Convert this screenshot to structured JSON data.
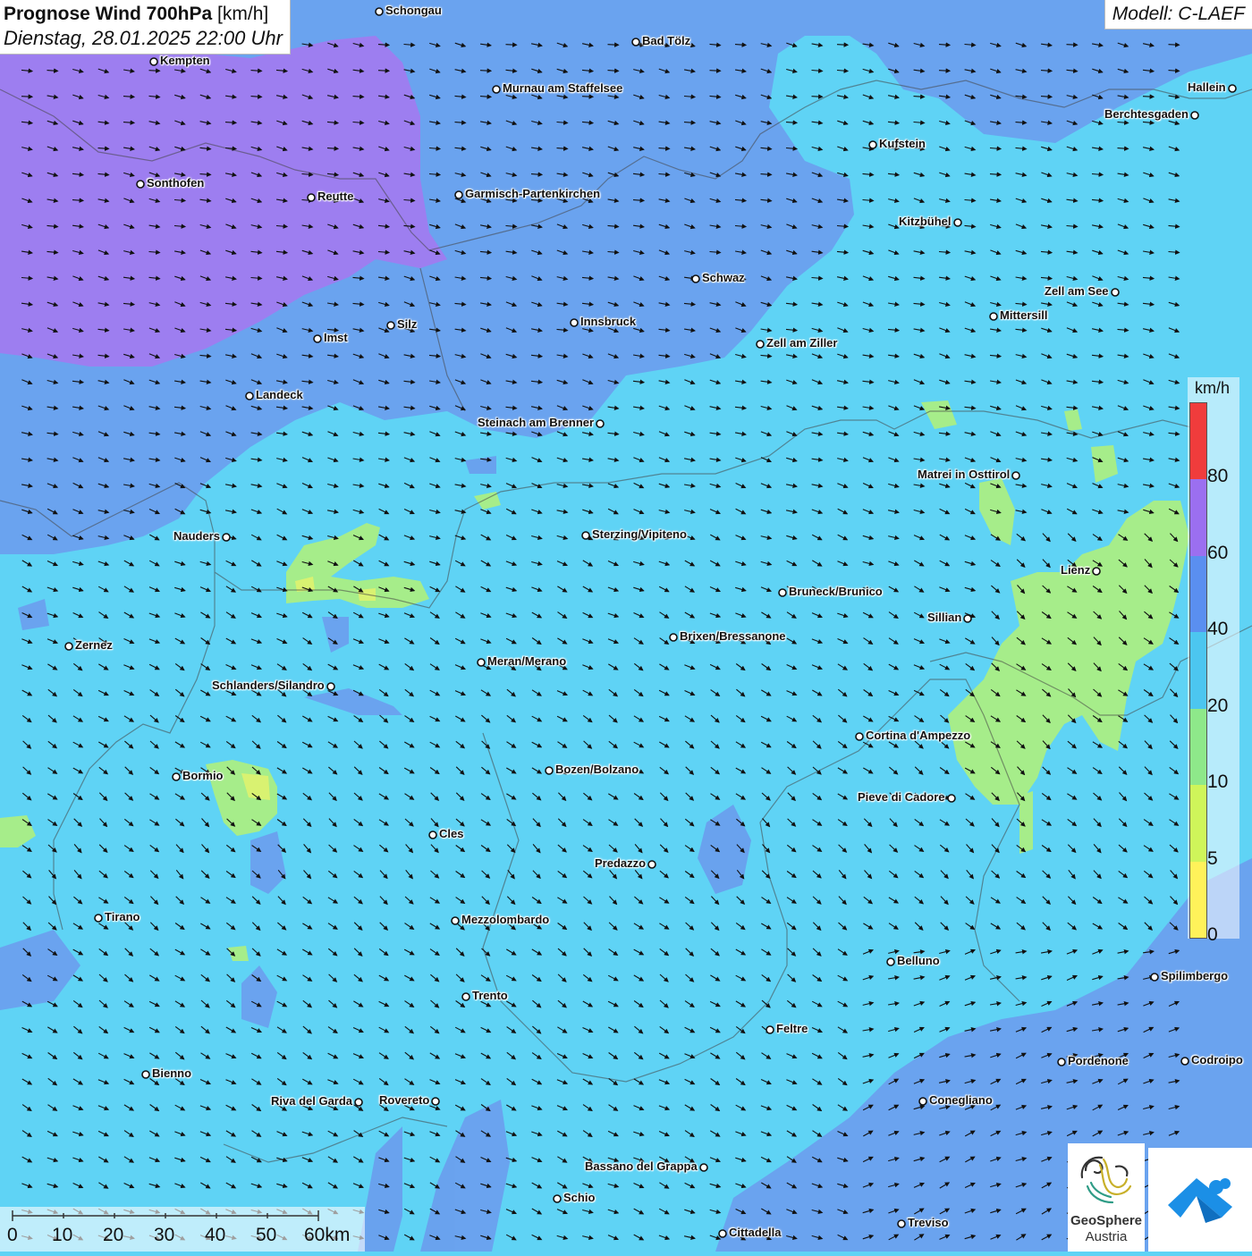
{
  "header": {
    "title_bold": "Prognose Wind 700hPa",
    "title_unit": " [km/h]",
    "datetime": "Dienstag, 28.01.2025 22:00 Uhr",
    "model": "Modell: C-LAEF"
  },
  "legend": {
    "unit": "km/h",
    "ticks": [
      "0",
      "5",
      "10",
      "20",
      "40",
      "60",
      "80"
    ],
    "colors": [
      "#fff25a",
      "#cff55a",
      "#8ee88a",
      "#4cc6f0",
      "#5a8ff0",
      "#9b6ff0",
      "#f03c3c"
    ]
  },
  "colors": {
    "wind_10_20": "#5fd3f5",
    "wind_20_40": "#6aa0ee",
    "wind_40_60": "#9d7ef0",
    "wind_5_10": "#a6ed8a",
    "wind_0_5": "#e6f36a"
  },
  "scale_bar": {
    "labels": [
      "0",
      "10",
      "20",
      "30",
      "40",
      "50",
      "60km"
    ]
  },
  "logos": {
    "geosphere_line1": "GeoSphere",
    "geosphere_line2": "Austria",
    "geosphere_icon": "geosphere-logo-icon",
    "app_icon": "wetter-app-logo-icon"
  },
  "cities": [
    "Schongau",
    "Bad Tölz",
    "Kempten",
    "Murnau am Staffelsee",
    "Hallein",
    "Berchtesgaden",
    "Kufstein",
    "Sonthofen",
    "Reutte",
    "Garmisch-Partenkirchen",
    "Kitzbühel",
    "Schwaz",
    "Zell am See",
    "Innsbruck",
    "Silz",
    "Imst",
    "Mittersill",
    "Zell am Ziller",
    "Landeck",
    "Steinach am Brenner",
    "Matrei in Osttirol",
    "Nauders",
    "Sterzing/Vipiteno",
    "Lienz",
    "Bruneck/Brunico",
    "Sillian",
    "Zernez",
    "Brixen/Bressanone",
    "Meran/Merano",
    "Schlanders/Silandro",
    "Cortina d'Ampezzo",
    "Bozen/Bolzano",
    "Bormio",
    "Pieve di Cadore",
    "Cles",
    "Predazzo",
    "Tirano",
    "Mezzolombardo",
    "Belluno",
    "Spilimbergo",
    "Trento",
    "Feltre",
    "Pordenone",
    "Codroipo",
    "Bienno",
    "Riva del Garda",
    "Rovereto",
    "Conegliano",
    "Bassano del Grappa",
    "Schio",
    "Treviso",
    "Cittadella"
  ]
}
